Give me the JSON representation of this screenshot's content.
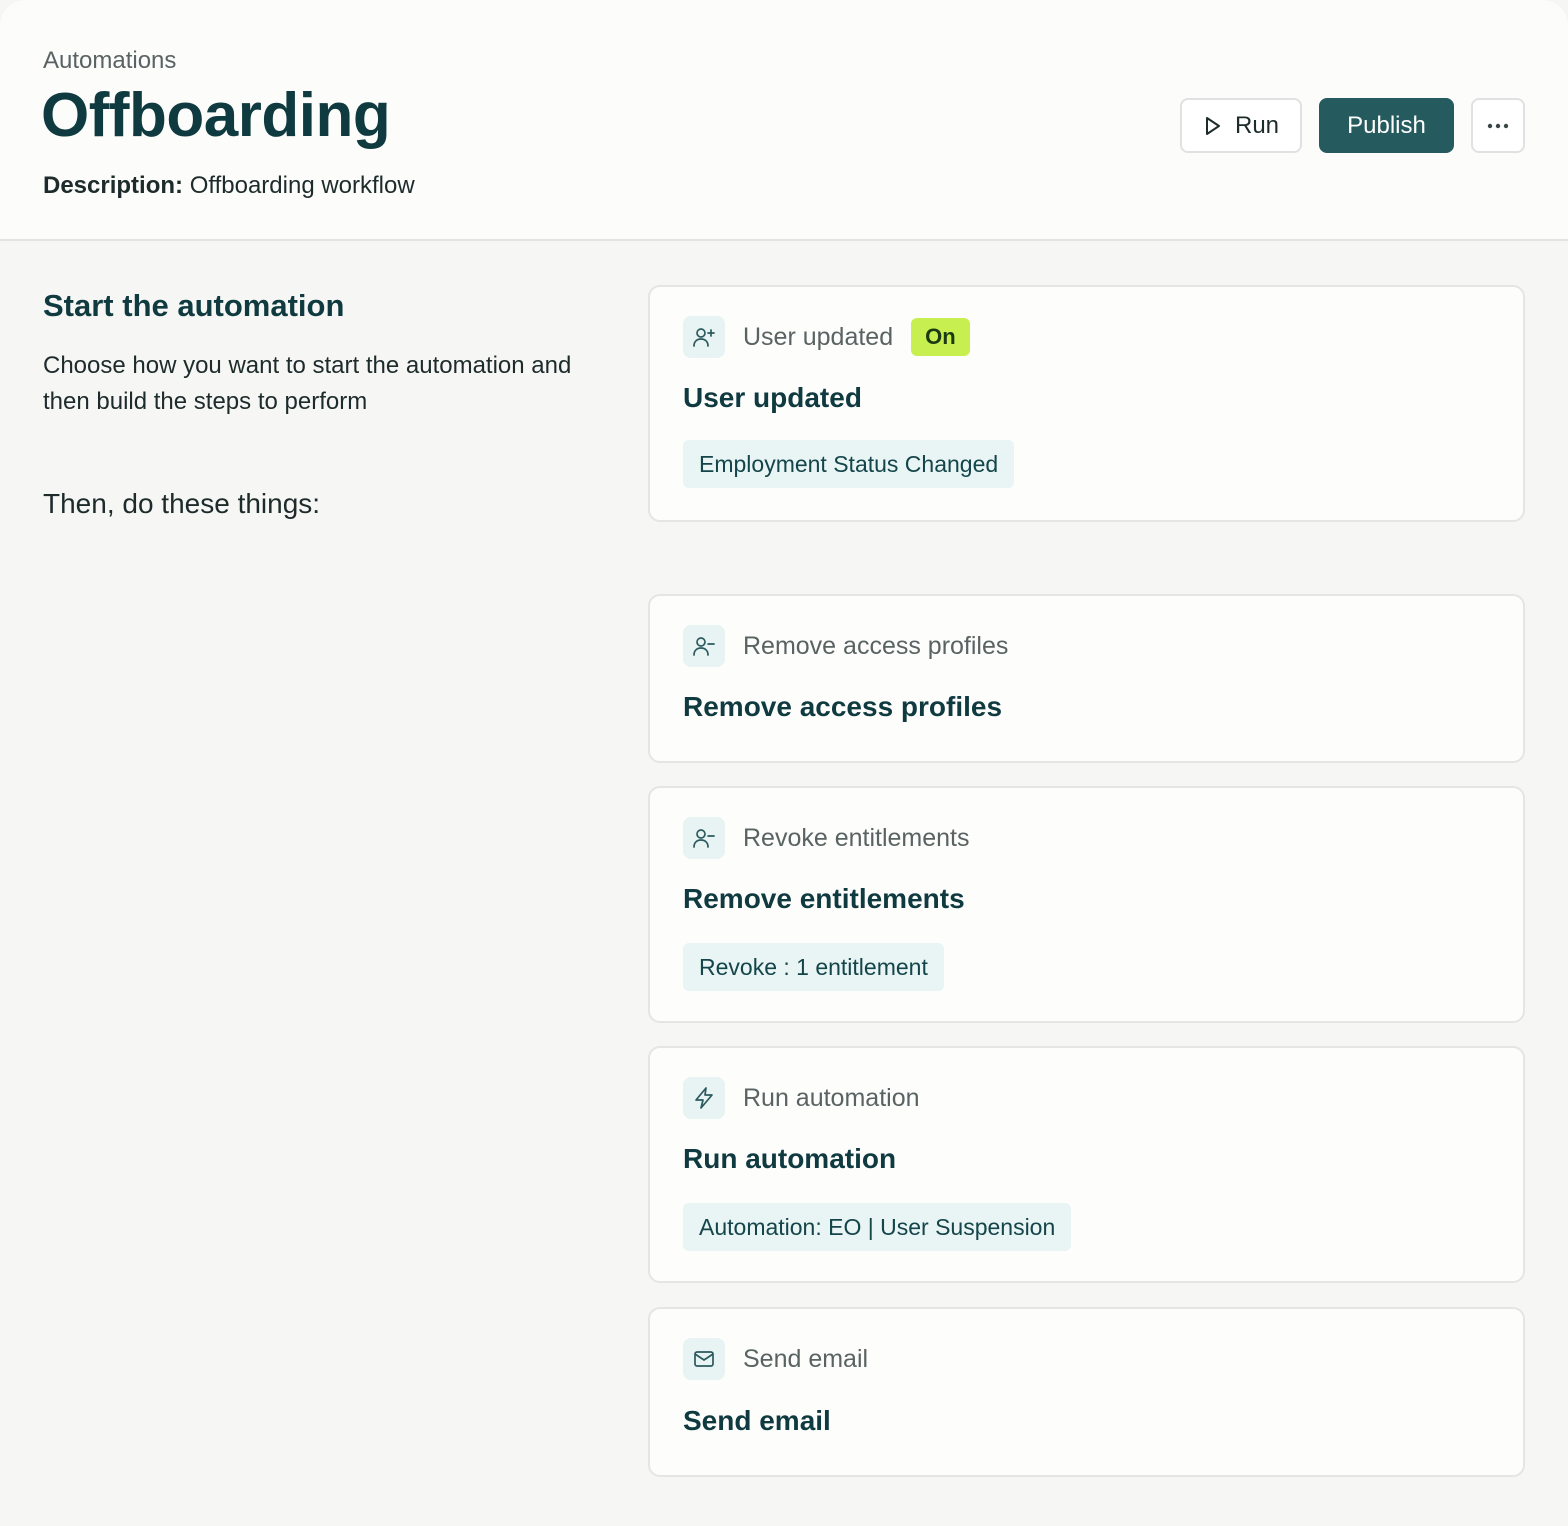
{
  "header": {
    "breadcrumb": "Automations",
    "title": "Offboarding",
    "description_label": "Description:",
    "description_value": "Offboarding workflow",
    "run_label": "Run",
    "publish_label": "Publish",
    "more_label": "···"
  },
  "intro": {
    "title": "Start the automation",
    "description": "Choose how you want to start the automation and then build the steps to perform",
    "then_label": "Then, do these things:"
  },
  "trigger": {
    "icon": "user-plus-icon",
    "type_label": "User updated",
    "status_badge": "On",
    "title": "User updated",
    "chip": "Employment Status Changed"
  },
  "steps": [
    {
      "icon": "user-minus-icon",
      "type_label": "Remove access profiles",
      "title": "Remove access profiles",
      "chip": ""
    },
    {
      "icon": "user-minus-icon",
      "type_label": "Revoke entitlements",
      "title": "Remove entitlements",
      "chip": "Revoke : 1 entitlement"
    },
    {
      "icon": "lightning-icon",
      "type_label": "Run automation",
      "title": "Run automation",
      "chip": "Automation: EO | User Suspension"
    },
    {
      "icon": "mail-icon",
      "type_label": "Send email",
      "title": "Send email",
      "chip": ""
    }
  ],
  "colors": {
    "brand": "#0f3a40",
    "publish_button": "#255a5e",
    "on_badge": "#c6ef4f",
    "chip_background": "#e9f4f4"
  }
}
